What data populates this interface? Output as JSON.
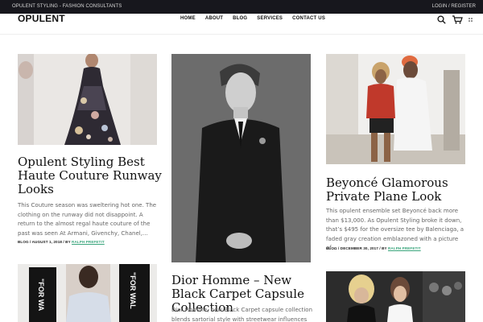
{
  "topbar": {
    "tagline": "OPULENT STYLING - FASHION CONSULTANTS",
    "login": "LOGIN / REGISTER"
  },
  "header": {
    "logo": "OPULENT",
    "nav": [
      "HOME",
      "ABOUT",
      "BLOG",
      "SERVICES",
      "CONTACT US"
    ]
  },
  "posts": [
    {
      "title": "Opulent Styling Best Haute Couture Runway Looks",
      "excerpt": "This Couture season was sweltering hot one. The clothing on the runway did not disappoint. A return to the almost regal haute couture of the past was seen At Armani, Givenchy, Chanel,…",
      "meta_prefix": "BLOG / AUGUST 1, 2018 / BY",
      "author": "RALPH PREFETIT"
    },
    {
      "title": "Beyoncé Glamorous Private Plane Look",
      "excerpt": "This opulent ensemble set Beyoncé back more than $13,000. As Opulent Styling broke it down, that’s $495 for the oversize tee by Balenciaga, a faded gray creation emblazoned with a picture of…",
      "meta_prefix": "BLOG / DECEMBER 30, 2017 / BY",
      "author": "RALPH PREFETIT"
    },
    {
      "title": "Dior Homme – New Black Carpet Capsule Collection",
      "excerpt": "Dior Homme, new Black Carpet capsule collection blends sartorial style with streetwear influences to"
    }
  ],
  "images": {
    "post1": "runway-gown-photo",
    "post2": "black-suit-portrait-photo",
    "post3": "celebrity-couple-photo",
    "post4": "for-walking-boots-photo",
    "post5": "red-carpet-photo"
  },
  "image_text": {
    "post4_left": "\"FOR WA",
    "post4_right": "\"FOR WAL"
  },
  "colors": {
    "topbar_bg": "#17171d",
    "author_link": "#3aa57c",
    "cart_icon": "#111111"
  }
}
